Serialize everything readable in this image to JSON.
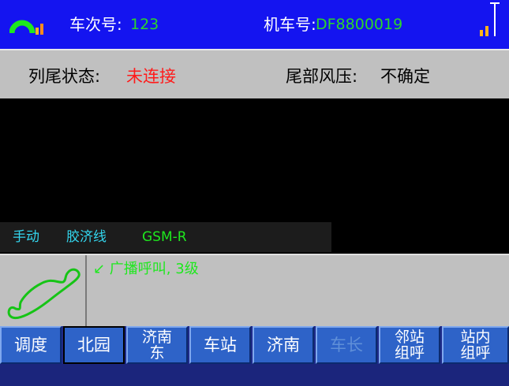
{
  "topbar": {
    "train_label": "车次号:",
    "train_number": "123",
    "loco_label": "机车号:",
    "loco_number": "DF8800019",
    "signal_icon": "signal-strength-icon",
    "antenna_icon": "antenna-signal-icon"
  },
  "status": {
    "tail_label": "列尾状态:",
    "tail_value": "未连接",
    "pressure_label": "尾部风压:",
    "pressure_value": "不确定"
  },
  "info": {
    "mode": "手动",
    "line": "胶济线",
    "network": "GSM-R"
  },
  "call": {
    "status_text": "↙ 广播呼叫, 3级",
    "phone_icon": "phone-handset-icon"
  },
  "buttons": [
    {
      "label": "调度"
    },
    {
      "label": "北园"
    },
    {
      "label": "济南东"
    },
    {
      "label": "车站"
    },
    {
      "label": "济南"
    },
    {
      "label": "车长"
    },
    {
      "label": "邻站组呼"
    },
    {
      "label": "站内组呼"
    }
  ],
  "colors": {
    "topbar_bg": "#1414f0",
    "value_green": "#2bd62b",
    "alert_red": "#ff1a1a",
    "info_cyan": "#33d6ee",
    "button_blue": "#2e63c8"
  }
}
